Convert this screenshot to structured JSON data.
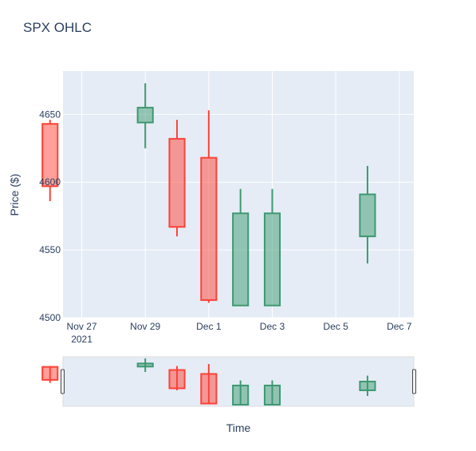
{
  "chart_data": {
    "type": "candlestick",
    "title": "SPX OHLC",
    "xlabel": "Time",
    "ylabel": "Price ($)",
    "ylim": [
      4500,
      4682
    ],
    "yticks": [
      4500,
      4550,
      4600,
      4650
    ],
    "xticks": [
      {
        "date": "2021-11-27",
        "label": "Nov 27",
        "sublabel": "2021"
      },
      {
        "date": "2021-11-29",
        "label": "Nov 29",
        "sublabel": ""
      },
      {
        "date": "2021-12-01",
        "label": "Dec 1",
        "sublabel": ""
      },
      {
        "date": "2021-12-03",
        "label": "Dec 3",
        "sublabel": ""
      },
      {
        "date": "2021-12-05",
        "label": "Dec 5",
        "sublabel": ""
      },
      {
        "date": "2021-12-07",
        "label": "Dec 7",
        "sublabel": ""
      }
    ],
    "candles": [
      {
        "date": "2021-11-26",
        "open": 4643,
        "high": 4646,
        "low": 4586,
        "close": 4597
      },
      {
        "date": "2021-11-29",
        "open": 4644,
        "high": 4673,
        "low": 4625,
        "close": 4655
      },
      {
        "date": "2021-11-30",
        "open": 4632,
        "high": 4646,
        "low": 4560,
        "close": 4567
      },
      {
        "date": "2021-12-01",
        "open": 4618,
        "high": 4653,
        "low": 4511,
        "close": 4513
      },
      {
        "date": "2021-12-02",
        "open": 4509,
        "high": 4595,
        "low": 4509,
        "close": 4577
      },
      {
        "date": "2021-12-03",
        "open": 4509,
        "high": 4595,
        "low": 4509,
        "close": 4577
      },
      {
        "date": "2021-12-06",
        "open": 4560,
        "high": 4612,
        "low": 4540,
        "close": 4591
      }
    ],
    "colors": {
      "increasing_line": "#3d9970",
      "increasing_fill": "rgba(61,153,112,0.5)",
      "decreasing_line": "#ff4136",
      "decreasing_fill": "rgba(255,65,54,0.5)",
      "plot_bg": "#e5ecf6",
      "grid": "#ffffff",
      "text": "#2a3f5f"
    },
    "grid": true,
    "rangeslider": true
  }
}
